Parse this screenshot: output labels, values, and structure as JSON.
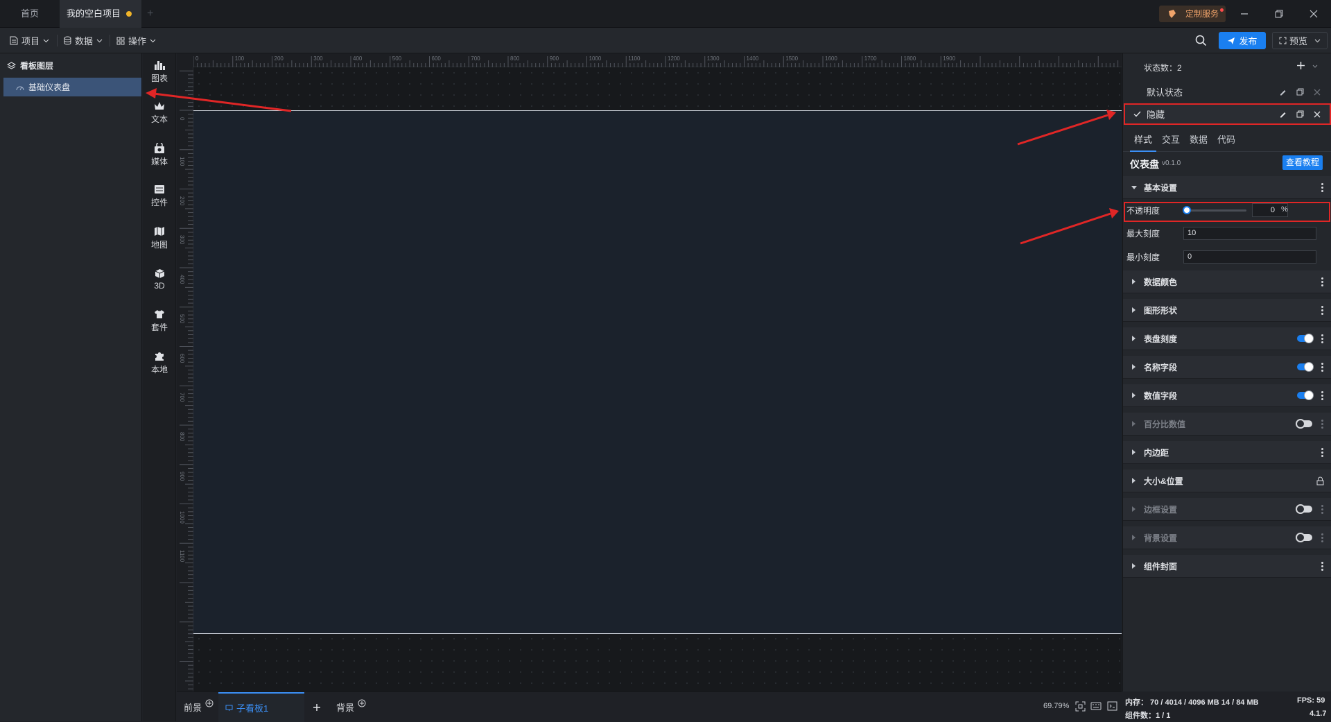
{
  "window": {
    "tabs": [
      {
        "label": "首页"
      },
      {
        "label": "我的空白项目"
      }
    ],
    "custom_service": "定制服务"
  },
  "toolbar": {
    "menus": [
      {
        "label": "项目"
      },
      {
        "label": "数据"
      },
      {
        "label": "操作"
      }
    ],
    "publish": "发布",
    "preview": "预览"
  },
  "layers": {
    "title": "看板图层",
    "items": [
      {
        "label": "基础仪表盘"
      }
    ]
  },
  "categories": [
    {
      "label": "图表",
      "icon": "bar-chart-icon"
    },
    {
      "label": "文本",
      "icon": "crown-icon"
    },
    {
      "label": "媒体",
      "icon": "camera-bag-icon"
    },
    {
      "label": "控件",
      "icon": "control-icon"
    },
    {
      "label": "地图",
      "icon": "map-icon"
    },
    {
      "label": "3D",
      "icon": "cube-icon"
    },
    {
      "label": "套件",
      "icon": "shirt-icon"
    },
    {
      "label": "本地",
      "icon": "puzzle-icon"
    }
  ],
  "ruler": {
    "top": [
      "0",
      "100",
      "200",
      "300",
      "400",
      "500",
      "600",
      "700",
      "800",
      "900",
      "1000",
      "1100",
      "1200",
      "1300",
      "1400",
      "1500",
      "1600",
      "1700",
      "1800",
      "1900"
    ],
    "left": [
      "0",
      "100",
      "200",
      "300",
      "400",
      "500",
      "600",
      "700",
      "800",
      "900",
      "1000",
      "1100"
    ]
  },
  "bottom": {
    "tabs": [
      {
        "label": "前景"
      },
      {
        "label": "子看板1"
      },
      {
        "label": "背景"
      }
    ],
    "zoom": "69.79%"
  },
  "right_panel": {
    "state_count": "状态数：2",
    "states": [
      {
        "label": "默认状态"
      },
      {
        "label": "隐藏"
      }
    ],
    "tabs": [
      {
        "label": "样式"
      },
      {
        "label": "交互"
      },
      {
        "label": "数据"
      },
      {
        "label": "代码"
      }
    ],
    "component": {
      "name": "仪表盘",
      "version": "v0.1.0",
      "tutorial": "查看教程"
    },
    "basic": {
      "title": "基本设置",
      "opacity_label": "不透明度",
      "opacity_value": "0",
      "opacity_unit": "%",
      "max_scale_label": "最大刻度",
      "max_scale_value": "10",
      "min_scale_label": "最小刻度",
      "min_scale_value": "0"
    },
    "sections": [
      {
        "label": "数据颜色",
        "control": "menu"
      },
      {
        "label": "图形形状",
        "control": "menu"
      },
      {
        "label": "表盘刻度",
        "control": "toggle-on"
      },
      {
        "label": "名称字段",
        "control": "toggle-on"
      },
      {
        "label": "数值字段",
        "control": "toggle-on"
      },
      {
        "label": "百分比数值",
        "control": "toggle-off"
      },
      {
        "label": "内边距",
        "control": "menu"
      },
      {
        "label": "大小&位置",
        "control": "lock"
      },
      {
        "label": "边框设置",
        "control": "toggle-off"
      },
      {
        "label": "背景设置",
        "control": "toggle-off"
      },
      {
        "label": "组件封面",
        "control": "menu"
      }
    ]
  },
  "status": {
    "memory": "内存： 70 / 4014 / 4096 MB  14 / 84 MB",
    "fps": "FPS:  59",
    "components": "组件数：1 / 1",
    "version": "4.1.7"
  },
  "colors": {
    "accent": "#1a7ff0",
    "annotation": "#e02626",
    "layer_selected": "#3b5478"
  }
}
